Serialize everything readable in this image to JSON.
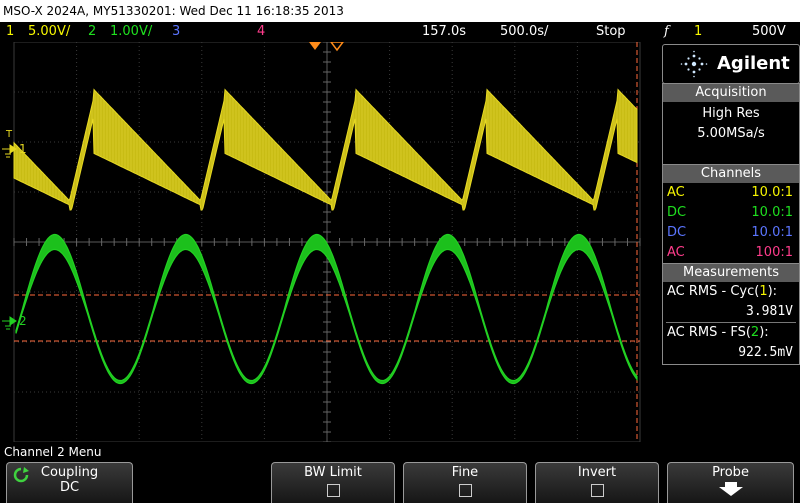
{
  "title_bar": {
    "text": "MSO-X 2024A, MY51330201: Wed Dec 11 16:18:35 2013"
  },
  "status": {
    "ch1_num": "1",
    "ch1_scale": "5.00V/",
    "ch2_num": "2",
    "ch2_scale": "1.00V/",
    "ch3_num": "3",
    "ch4_num": "4",
    "delay": "157.0s",
    "timebase": "500.0s/",
    "run_state": "Stop",
    "trig_symbol": "f",
    "trig_source": "1",
    "trig_level": "500V"
  },
  "markers": {
    "ch1": "1",
    "ch2": "2",
    "trig_t": "T"
  },
  "brand": {
    "name": "Agilent"
  },
  "acquisition": {
    "header": "Acquisition",
    "mode": "High Res",
    "rate": "5.00MSa/s"
  },
  "channels": {
    "header": "Channels",
    "rows": [
      {
        "coupling": "AC",
        "probe": "10.0:1",
        "color": "#f7f700"
      },
      {
        "coupling": "DC",
        "probe": "10.0:1",
        "color": "#1fe01f"
      },
      {
        "coupling": "DC",
        "probe": "10.0:1",
        "color": "#5b75ff"
      },
      {
        "coupling": "AC",
        "probe": "100:1",
        "color": "#ff3c8c"
      }
    ]
  },
  "measurements": {
    "header": "Measurements",
    "m1_label": "AC RMS - Cyc",
    "m1_src": "1",
    "m1_value": "3.981V",
    "m2_label": "AC RMS - FS",
    "m2_src": "2",
    "m2_value": "922.5mV"
  },
  "menu": {
    "title": "Channel 2 Menu"
  },
  "softkeys": {
    "coupling_label": "Coupling",
    "coupling_value": "DC",
    "bw_limit": "BW Limit",
    "fine": "Fine",
    "invert": "Invert",
    "probe": "Probe"
  },
  "colors": {
    "ch1": "#e6d820",
    "ch2": "#22d022",
    "ch3": "#6b74ff",
    "ch4": "#ff3c8c",
    "cursor": "#ff6a3d"
  }
}
